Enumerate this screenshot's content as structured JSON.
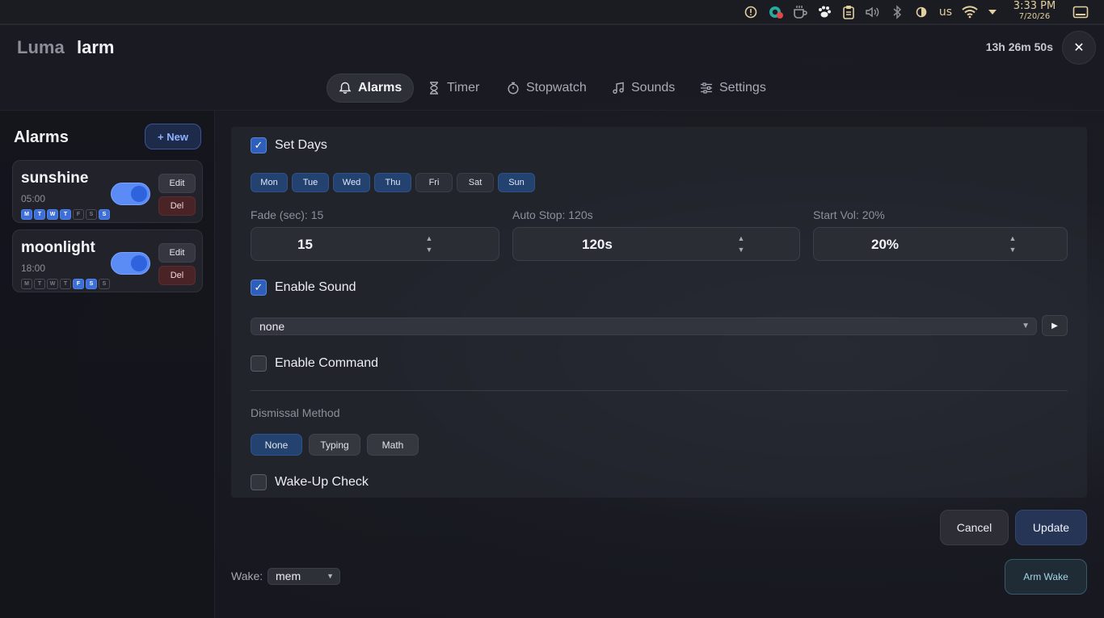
{
  "system_tray": {
    "keyboard_layout": "us",
    "time": "3:33 PM",
    "date": "7/20/26"
  },
  "app": {
    "title_part1": "Luma",
    "title_part2": "larm",
    "countdown": "13h 26m 50s",
    "close_label": "✕"
  },
  "tabs": [
    {
      "label": "Alarms",
      "icon": "bell-icon",
      "active": true
    },
    {
      "label": "Timer",
      "icon": "hourglass-icon",
      "active": false
    },
    {
      "label": "Stopwatch",
      "icon": "stopwatch-icon",
      "active": false
    },
    {
      "label": "Sounds",
      "icon": "music-note-icon",
      "active": false
    },
    {
      "label": "Settings",
      "icon": "sliders-icon",
      "active": false
    }
  ],
  "sidebar": {
    "title": "Alarms",
    "new_label": "+ New",
    "alarms": [
      {
        "name": "sunshine",
        "time": "05:00",
        "enabled": true,
        "days": [
          {
            "l": "M",
            "on": true
          },
          {
            "l": "T",
            "on": true
          },
          {
            "l": "W",
            "on": true
          },
          {
            "l": "T",
            "on": true
          },
          {
            "l": "F",
            "on": false
          },
          {
            "l": "S",
            "on": false
          },
          {
            "l": "S",
            "on": true
          }
        ],
        "edit_label": "Edit",
        "del_label": "Del"
      },
      {
        "name": "moonlight",
        "time": "18:00",
        "enabled": true,
        "days": [
          {
            "l": "M",
            "on": false
          },
          {
            "l": "T",
            "on": false
          },
          {
            "l": "W",
            "on": false
          },
          {
            "l": "T",
            "on": false
          },
          {
            "l": "F",
            "on": true
          },
          {
            "l": "S",
            "on": true
          },
          {
            "l": "S",
            "on": false
          }
        ],
        "edit_label": "Edit",
        "del_label": "Del"
      }
    ]
  },
  "editor": {
    "set_days": {
      "label": "Set Days",
      "checked": true
    },
    "days": [
      {
        "label": "Mon",
        "on": true
      },
      {
        "label": "Tue",
        "on": true
      },
      {
        "label": "Wed",
        "on": true
      },
      {
        "label": "Thu",
        "on": true
      },
      {
        "label": "Fri",
        "on": false
      },
      {
        "label": "Sat",
        "on": false
      },
      {
        "label": "Sun",
        "on": true
      }
    ],
    "fade": {
      "label": "Fade (sec): 15",
      "value": "15"
    },
    "auto_stop": {
      "label": "Auto Stop: 120s",
      "value": "120s"
    },
    "start_vol": {
      "label": "Start Vol: 20%",
      "value": "20%"
    },
    "spin_up": "▲",
    "spin_down": "▼",
    "enable_sound": {
      "label": "Enable Sound",
      "checked": true
    },
    "sound_select": {
      "value": "none",
      "caret": "▼"
    },
    "play_label": "▶",
    "enable_command": {
      "label": "Enable Command",
      "checked": false
    },
    "dismissal": {
      "label": "Dismissal Method",
      "options": [
        {
          "label": "None",
          "on": true
        },
        {
          "label": "Typing",
          "on": false
        },
        {
          "label": "Math",
          "on": false
        }
      ]
    },
    "wake_up_check": {
      "label": "Wake-Up Check",
      "checked": false
    }
  },
  "actions": {
    "cancel_label": "Cancel",
    "update_label": "Update",
    "arm_wake_label": "Arm Wake"
  },
  "wake": {
    "label": "Wake:",
    "value": "mem",
    "caret": "▼"
  },
  "colors": {
    "accent": "#3d6fd6",
    "selected_day": "#24426f",
    "delete": "#4a2326",
    "tray_icons": "#d8c49a"
  }
}
